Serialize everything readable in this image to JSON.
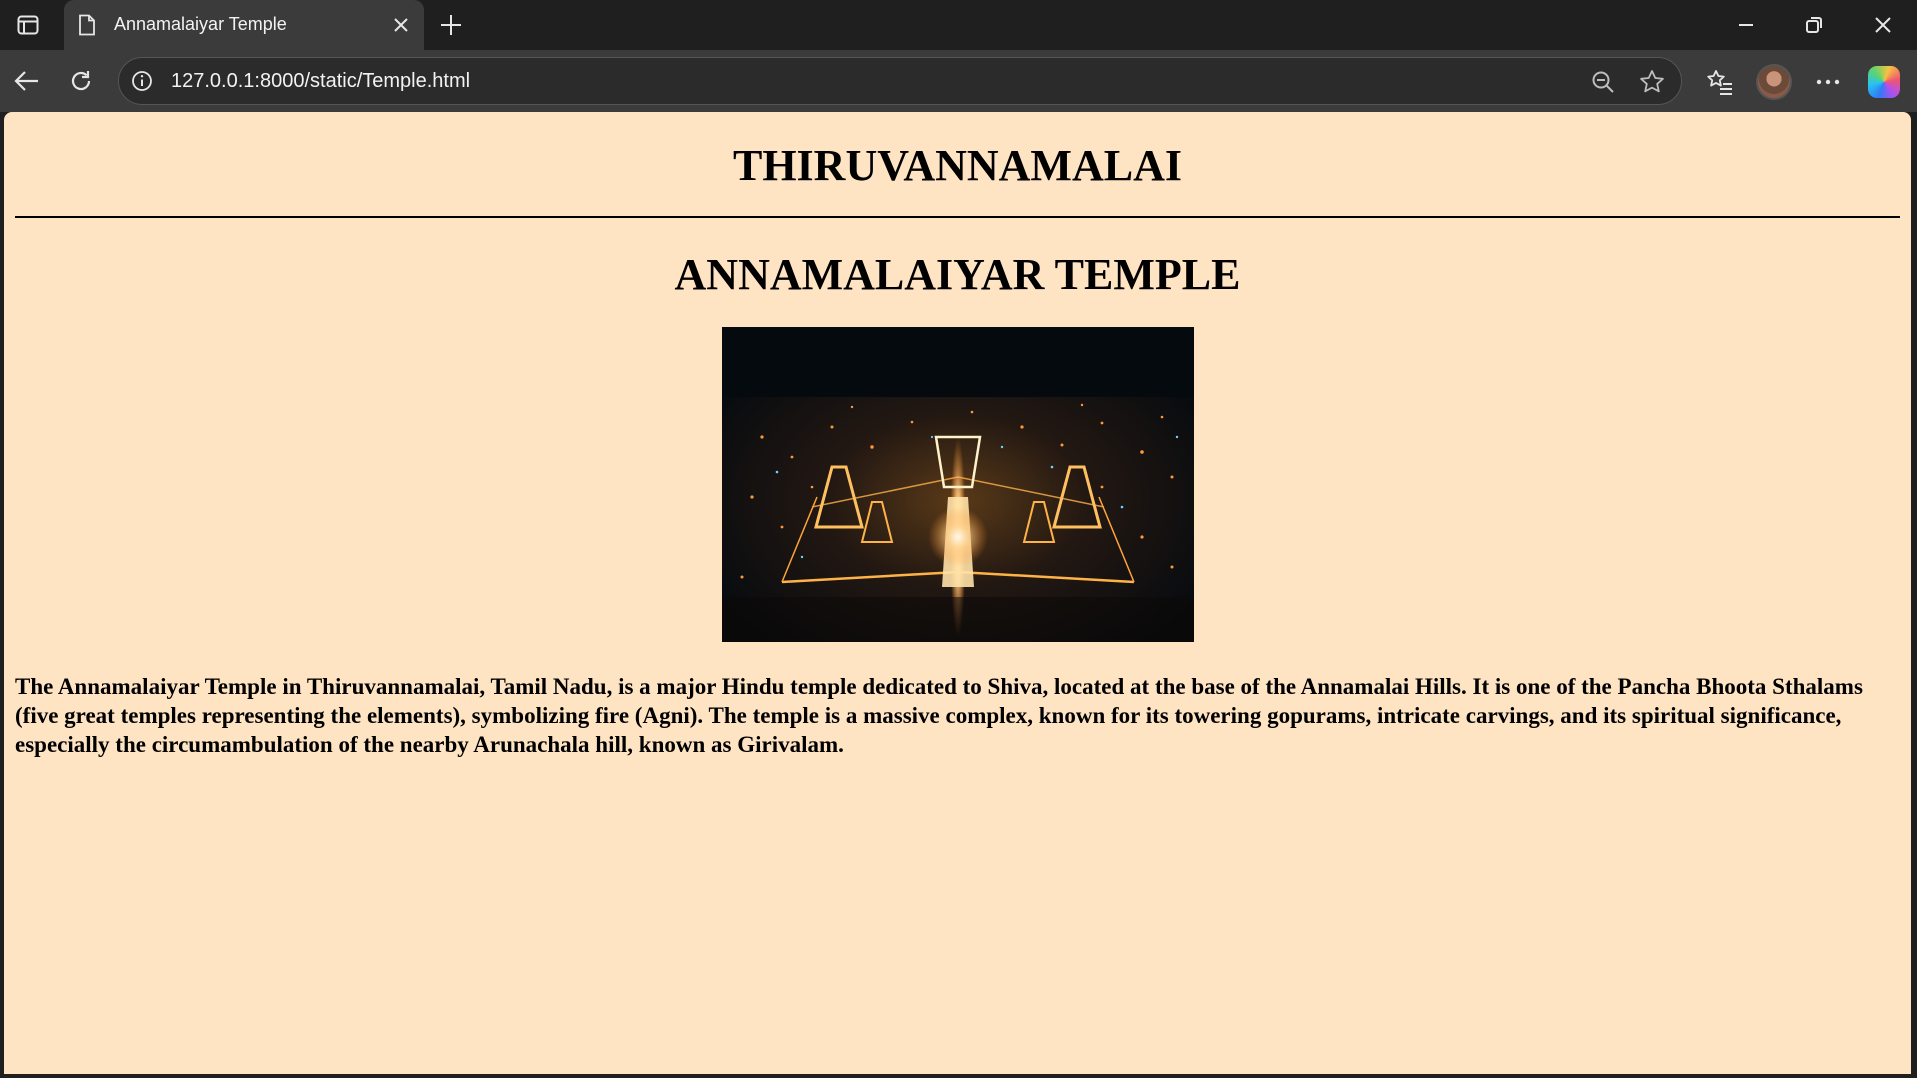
{
  "browser": {
    "tab_title": "Annamalaiyar Temple",
    "url": "127.0.0.1:8000/static/Temple.html",
    "icons": {
      "tab_strip": "tab-actions-icon",
      "favicon": "page-icon",
      "tab_close": "close-icon",
      "new_tab": "plus-icon",
      "minimize": "minimize-icon",
      "restore": "restore-icon",
      "close_window": "close-icon",
      "back": "back-arrow-icon",
      "reload": "reload-icon",
      "site_info": "info-icon",
      "zoom": "zoom-out-icon",
      "favorite": "star-icon",
      "favorites": "favorites-list-icon",
      "profile": "avatar",
      "menu": "more-icon",
      "copilot": "copilot-icon"
    }
  },
  "page": {
    "background": "#ffe4c4",
    "heading": "THIRUVANNAMALAI",
    "subheading": "ANNAMALAIYAR TEMPLE",
    "photo_description_icon": "temple-night-photo",
    "paragraph": "The Annamalaiyar Temple in Thiruvannamalai, Tamil Nadu, is a major Hindu temple dedicated to Shiva, located at the base of the Annamalai Hills. It is one of the Pancha Bhoota Sthalams (five great temples representing the elements), symbolizing fire (Agni). The temple is a massive complex, known for its towering gopurams, intricate carvings, and its spiritual significance, especially the circumambulation of the nearby Arunachala hill, known as Girivalam."
  }
}
